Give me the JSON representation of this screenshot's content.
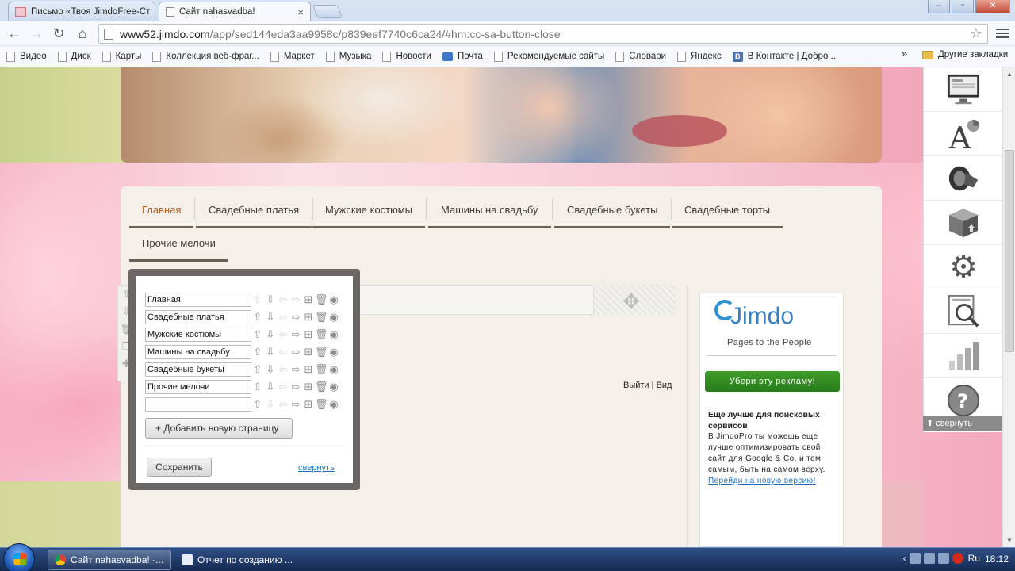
{
  "browser": {
    "tabs": [
      {
        "label": "Письмо «Твоя JimdoFree-Ст",
        "active": false
      },
      {
        "label": "Сайт nahasvadba!",
        "active": true
      }
    ],
    "close_glyph": "×",
    "window_buttons": {
      "minimize": "–",
      "maximize": "▫",
      "close": "✕"
    },
    "url_host": "www52.jimdo.com",
    "url_path": "/app/sed144eda3aa9958c/p839eef7740c6ca24/#hm:cc-sa-button-close",
    "bookmarks": [
      {
        "label": "Видео",
        "icon": "page-icon"
      },
      {
        "label": "Диск",
        "icon": "page-icon"
      },
      {
        "label": "Карты",
        "icon": "page-icon"
      },
      {
        "label": "Коллекция веб-фраг...",
        "icon": "page-icon"
      },
      {
        "label": "Маркет",
        "icon": "page-icon"
      },
      {
        "label": "Музыка",
        "icon": "page-icon"
      },
      {
        "label": "Новости",
        "icon": "page-icon"
      },
      {
        "label": "Почта",
        "icon": "mail-icon"
      },
      {
        "label": "Рекомендуемые сайты",
        "icon": "page-icon"
      },
      {
        "label": "Словари",
        "icon": "page-icon"
      },
      {
        "label": "Яндекс",
        "icon": "page-icon"
      },
      {
        "label": "В Контакте | Добро ...",
        "icon": "vk-icon"
      }
    ],
    "bookmarks_more": "»",
    "other_bookmarks": "Другие закладки"
  },
  "site": {
    "nav": [
      "Главная",
      "Свадебные платья",
      "Мужские костюмы",
      "Машины на свадьбу",
      "Свадебные букеты",
      "Свадебные торты",
      "Прочие мелочи"
    ],
    "logout": "Выйти",
    "logout_sep": " | ",
    "view": "Вид"
  },
  "page_editor": {
    "pages": [
      "Главная",
      "Свадебные платья",
      "Мужские костюмы",
      "Машины на свадьбу",
      "Свадебные букеты",
      "Прочие мелочи",
      ""
    ],
    "add_button": "+  Добавить новую страницу",
    "save_button": "Сохранить",
    "collapse_link": "свернуть"
  },
  "ad": {
    "logo_word": "Jimdo",
    "logo_tagline": "Pages to the People",
    "remove_ads_button": "Убери эту рекламу!",
    "heading": "Еще лучше для поисковых сервисов",
    "text": "В JimdoPro ты можешь еще лучше оптимизировать свой сайт для Google & Co. и тем самым, быть на самом верху.",
    "link": "Перейди на новую версию!"
  },
  "jimdo_panel": {
    "items": [
      "layout-icon",
      "typography-icon",
      "promote-icon",
      "store-icon",
      "settings-icon",
      "seo-icon",
      "statistics-icon",
      "help-icon"
    ],
    "collapse_label": "свернуть"
  },
  "taskbar": {
    "buttons": [
      "Сайт nahasvadba! -...",
      "Отчет по созданию ..."
    ],
    "language": "Ru",
    "clock": "18:12"
  }
}
